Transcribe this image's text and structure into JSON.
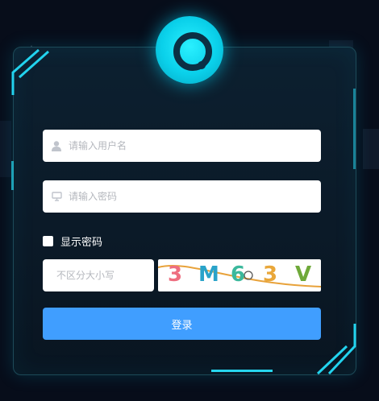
{
  "login": {
    "username_placeholder": "请输入用户名",
    "password_placeholder": "请输入密码",
    "show_password_label": "显示密码",
    "captcha_placeholder": "不区分大小写",
    "captcha_chars": [
      "3",
      "M",
      "6",
      "3",
      "V"
    ],
    "login_button_label": "登录"
  },
  "colors": {
    "accent": "#409eff",
    "cyan": "#22d3ee",
    "background": "#070d1a"
  },
  "icons": {
    "username": "user-icon",
    "password": "monitor-icon",
    "logo": "logo-icon"
  }
}
